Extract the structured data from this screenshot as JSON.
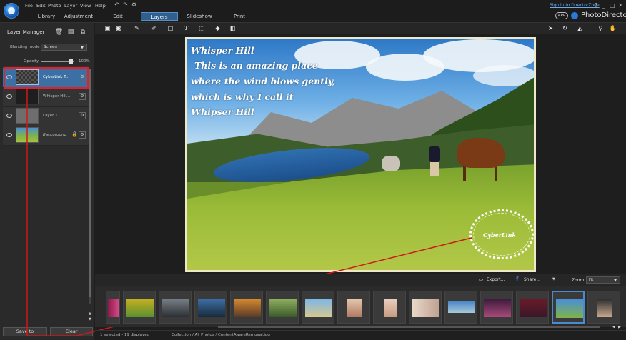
{
  "menu": {
    "items": [
      "File",
      "Edit",
      "Photo",
      "Layer",
      "View",
      "Help"
    ]
  },
  "modes": {
    "tabs": [
      "Library",
      "Adjustment",
      "Edit",
      "Layers",
      "Slideshow",
      "Print"
    ],
    "active": "Layers"
  },
  "account": {
    "signin": "Sign in to DirectorZone",
    "help": "?",
    "app_badge": "APP",
    "product": "PhotoDirector"
  },
  "layer_manager": {
    "title": "Layer Manager",
    "blending_label": "Blending mode",
    "blending_value": "Screen",
    "opacity_label": "Opacity",
    "opacity_value": "100%",
    "opacity_level": 1.0,
    "layers": [
      {
        "name": "CyberLink T...",
        "selected": true
      },
      {
        "name": "Whisper Hill...",
        "selected": false
      },
      {
        "name": "Layer 1",
        "selected": false
      },
      {
        "name": "Background",
        "selected": false
      }
    ],
    "save_to": "Save to",
    "clear": "Clear"
  },
  "photo": {
    "text_lines": [
      "Whisper Hill",
      "This is an amazing place",
      "where the wind blows gently,",
      "which is why I call it",
      "Whipser Hill"
    ],
    "watermark": "CyberLink"
  },
  "filmbar": {
    "export": "Export...",
    "share": "Share...",
    "zoom_label": "Zoom:",
    "zoom_value": "Fit"
  },
  "status": {
    "selection": "1 selected - 19 displayed",
    "path": "Collection / All Photos / ContentAwareRemoval.jpg"
  },
  "colors": {
    "accent": "#3c6fa3",
    "highlight": "#e0202a"
  }
}
